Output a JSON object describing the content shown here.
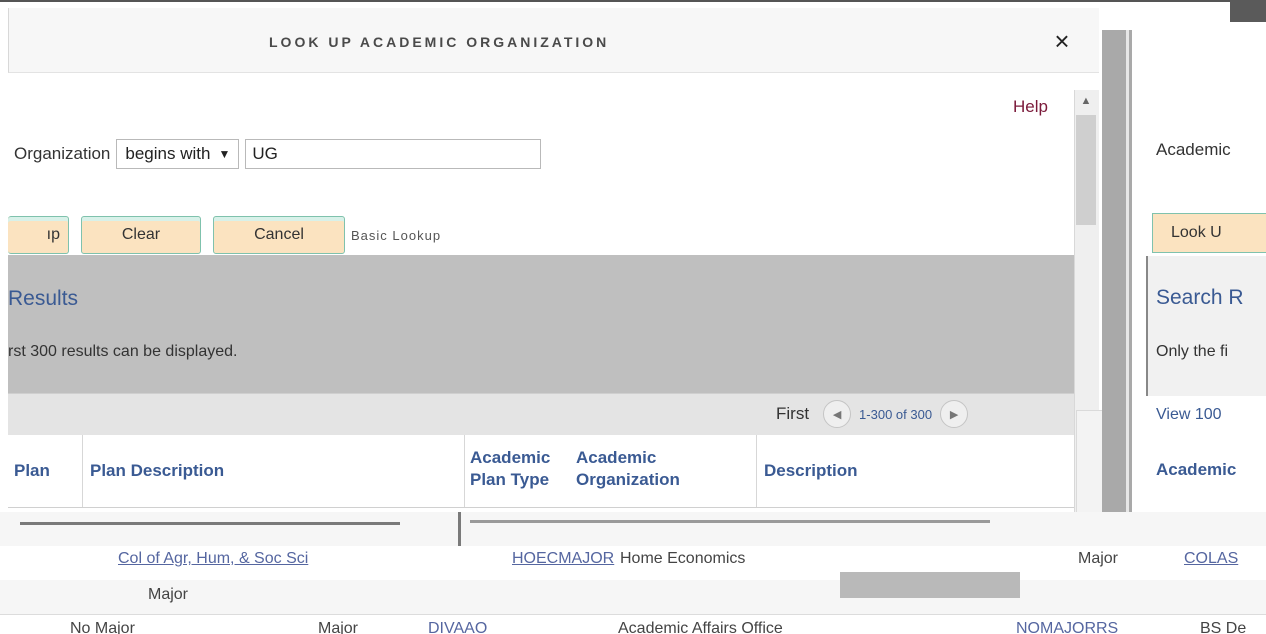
{
  "dialog": {
    "title": "LOOK UP ACADEMIC ORGANIZATION",
    "close_glyph": "×",
    "help_label": "Help"
  },
  "search": {
    "field_label": "Organization",
    "operator": "begins with",
    "operator_caret": "▼",
    "value": "UG"
  },
  "buttons": {
    "lookup_label": "Look Up",
    "lookup_visible_fragment": "ıp",
    "clear_label": "Clear",
    "cancel_label": "Cancel",
    "basic_lookup_label": "Basic Lookup"
  },
  "results": {
    "title": "Results",
    "note": "rst 300 results can be displayed.",
    "pager_first": "First",
    "pager_range": "1-300 of 300",
    "prev_glyph": "◀",
    "next_glyph": "▶"
  },
  "table": {
    "columns": [
      {
        "id": "plan",
        "label": "Plan"
      },
      {
        "id": "plan_description",
        "label": "Plan Description"
      },
      {
        "id": "plan_type",
        "label": "Academic Plan Type"
      },
      {
        "id": "organization",
        "label": "Academic Organization"
      },
      {
        "id": "description",
        "label": "Description"
      }
    ],
    "rows": [
      {
        "plan_description": "Col of Agr, Hum, & Soc Sci",
        "organization": "HOECMAJOR",
        "description": "Home Economics",
        "plan_type": "Major"
      },
      {
        "plan_description": "Major",
        "organization": "DIVAAO",
        "description": "Academic Affairs Office",
        "plan": "No Major",
        "plan_type": "Major"
      }
    ]
  },
  "background_window": {
    "academic_label": "Academic",
    "lookup_label": "Look U",
    "search_results": "Search R",
    "only_the": "Only the fi",
    "view_100": "View 100",
    "academic_col": "Academic",
    "code_1": "COLAS",
    "code_2": "NOMAJORRS",
    "code_3": "BS De"
  },
  "colors": {
    "link": "#3a5a93",
    "help": "#7b1a3a",
    "button_bg": "#fbe3c0",
    "button_border": "#7fc2ad",
    "panel_gray": "#bfbfbf"
  }
}
